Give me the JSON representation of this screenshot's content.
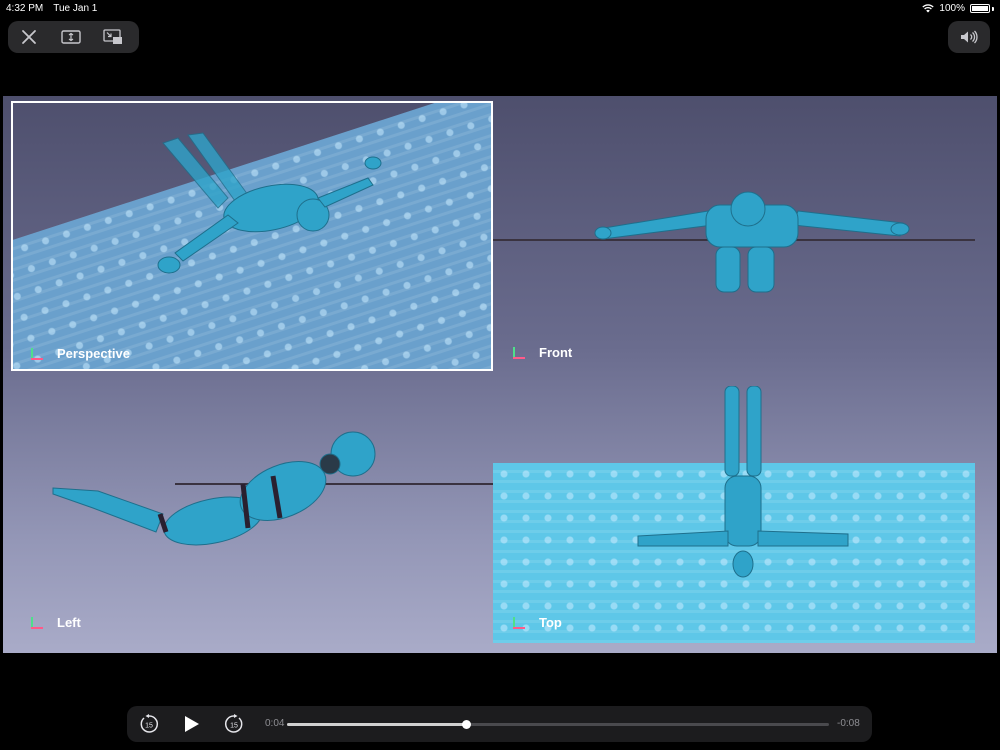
{
  "status_bar": {
    "time": "4:32 PM",
    "date": "Tue Jan 1",
    "battery": "100%"
  },
  "icons": {
    "close": "close-icon",
    "fit": "aspect-fit-icon",
    "pip": "picture-in-picture-icon",
    "volume": "speaker-volume-icon",
    "skip_back": "skip-back-15-icon",
    "play": "play-icon",
    "skip_forward": "skip-forward-15-icon"
  },
  "video": {
    "viewports": {
      "perspective": "Perspective",
      "front": "Front",
      "left": "Left",
      "top": "Top"
    },
    "floor_texture": "LEEDAR"
  },
  "playback": {
    "elapsed": "0:04",
    "remaining": "-0:08",
    "progress": 0.33,
    "skip_seconds": "15"
  },
  "colors": {
    "model": "#2fa3c9",
    "model_dark": "#1e6f8c",
    "selection": "#ffffff"
  }
}
